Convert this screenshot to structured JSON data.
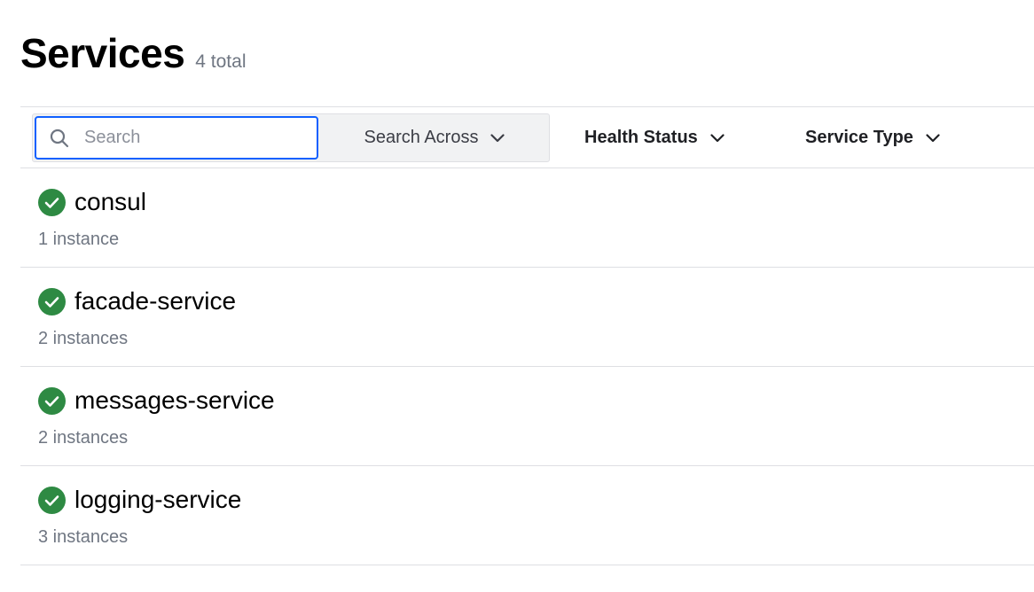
{
  "header": {
    "title": "Services",
    "count": "4 total"
  },
  "toolbar": {
    "search": {
      "placeholder": "Search",
      "value": "",
      "icon": "search-icon"
    },
    "search_across_label": "Search Across",
    "filters": {
      "health_status_label": "Health Status",
      "service_type_label": "Service Type"
    }
  },
  "colors": {
    "accent_focus": "#1060ff",
    "status_passing": "#2e8a43",
    "muted_text": "#6f7682",
    "border": "#dedfe3"
  },
  "services": [
    {
      "name": "consul",
      "instances": "1 instance",
      "status": "passing",
      "status_icon": "check-circle-icon"
    },
    {
      "name": "facade-service",
      "instances": "2 instances",
      "status": "passing",
      "status_icon": "check-circle-icon"
    },
    {
      "name": "messages-service",
      "instances": "2 instances",
      "status": "passing",
      "status_icon": "check-circle-icon"
    },
    {
      "name": "logging-service",
      "instances": "3 instances",
      "status": "passing",
      "status_icon": "check-circle-icon"
    }
  ]
}
